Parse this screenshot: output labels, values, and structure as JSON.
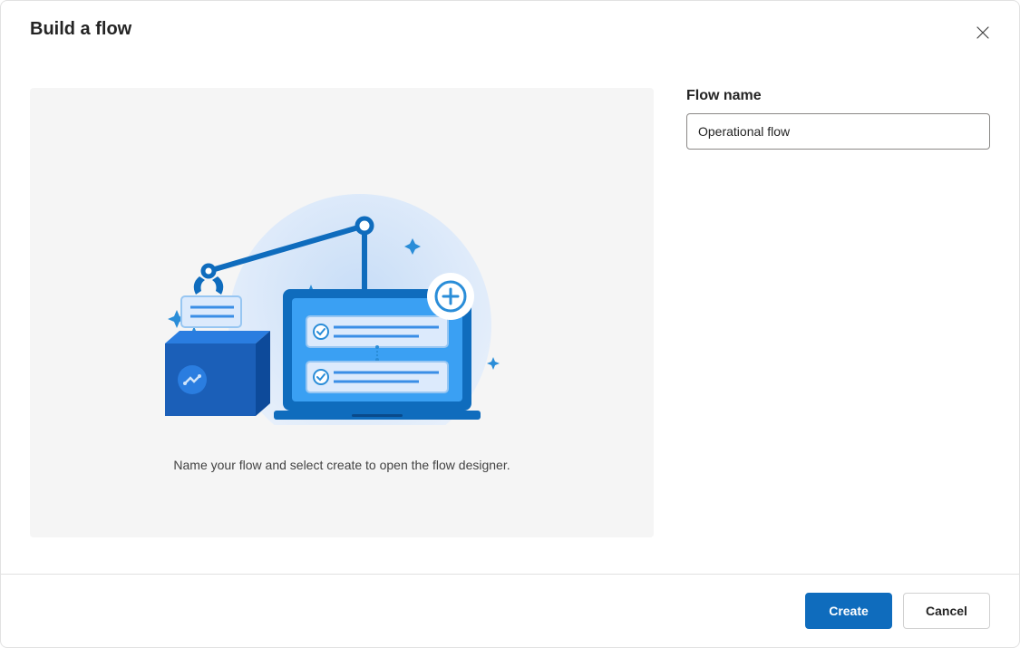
{
  "dialog": {
    "title": "Build a flow",
    "illustration_caption": "Name your flow and select create to open the flow designer."
  },
  "form": {
    "flow_name_label": "Flow name",
    "flow_name_value": "Operational flow"
  },
  "footer": {
    "create_label": "Create",
    "cancel_label": "Cancel"
  }
}
